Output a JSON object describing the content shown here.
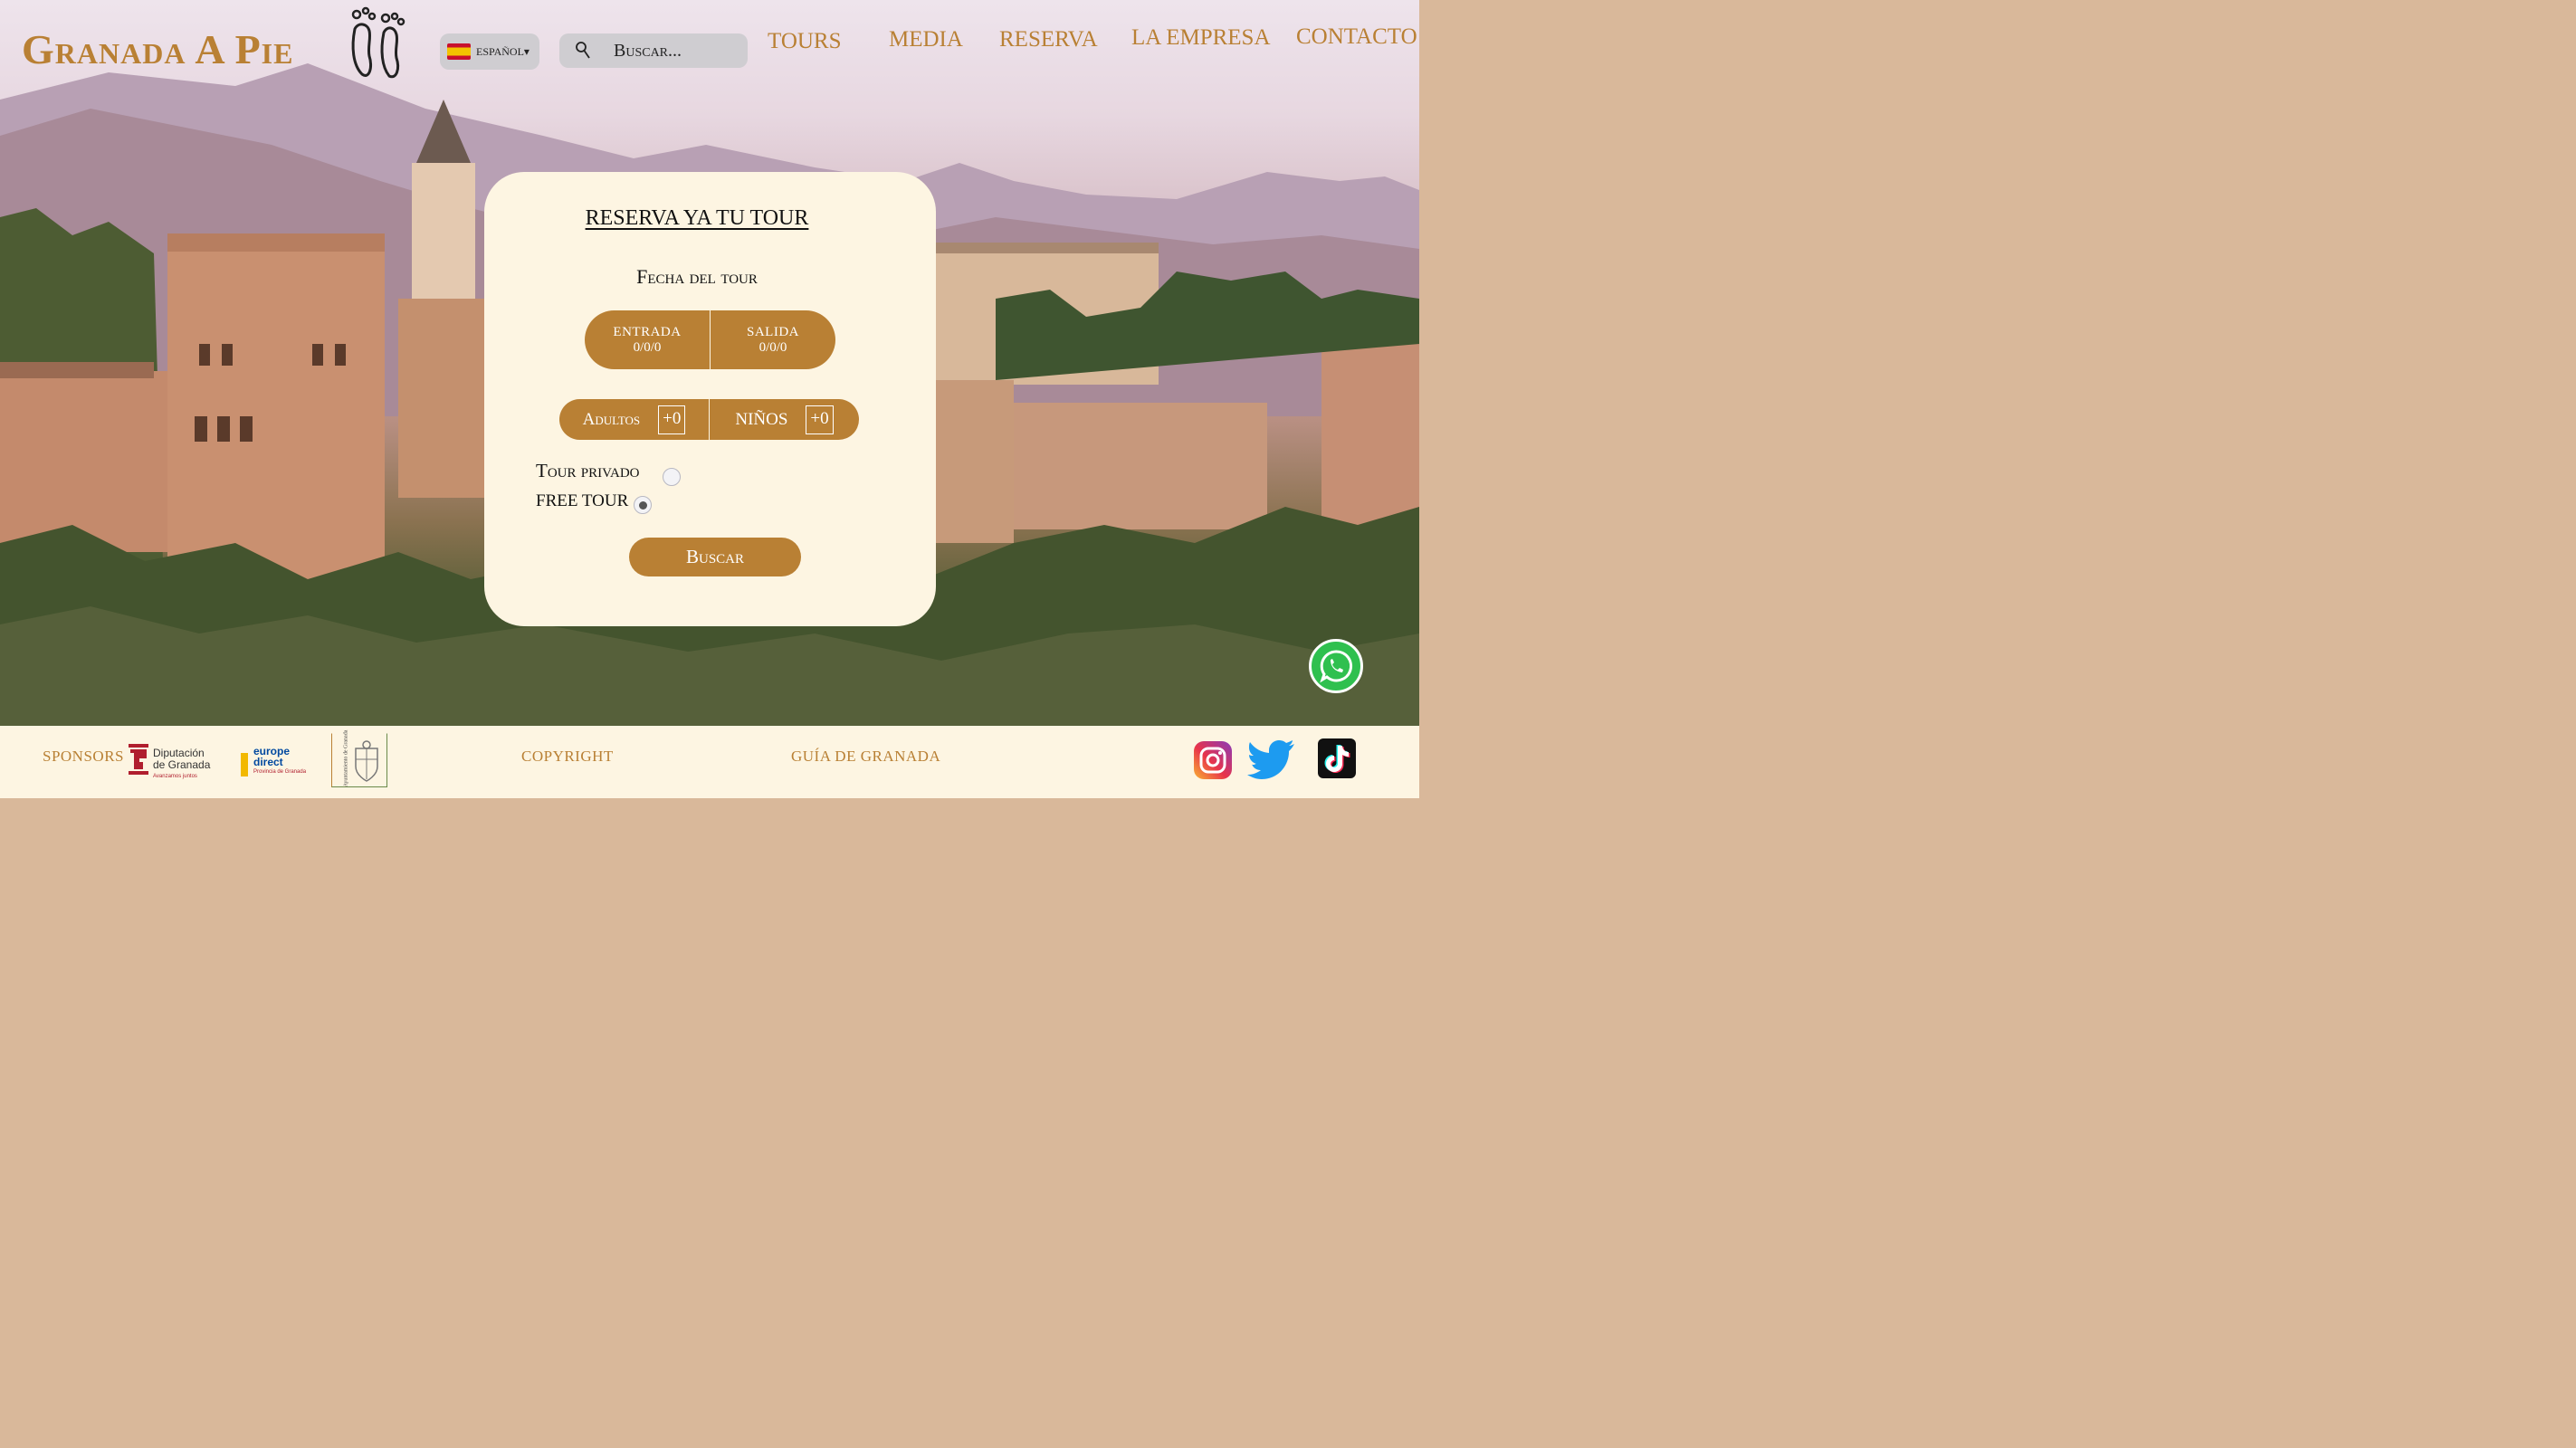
{
  "header": {
    "logo_text": "Granada A Pie",
    "language": {
      "label": "ESPAÑOL▾",
      "flag": "spain-flag"
    },
    "search": {
      "placeholder": "Buscar..."
    },
    "nav": [
      "TOURS",
      "MEDIA",
      "RESERVA",
      "LA EMPRESA",
      "CONTACTO"
    ]
  },
  "booking": {
    "title": "RESERVA YA TU TOUR",
    "date_label": "Fecha del tour",
    "entrada_label": "ENTRADA",
    "entrada_value": "0/0/0",
    "salida_label": "SALIDA",
    "salida_value": "0/0/0",
    "adultos_label": "Adultos",
    "adultos_value": "+0",
    "ninos_label": "NIÑOS",
    "ninos_value": "+0",
    "options": [
      {
        "label": "Tour privado",
        "selected": false
      },
      {
        "label": "FREE TOUR",
        "selected": true
      }
    ],
    "submit_label": "Buscar"
  },
  "footer": {
    "sponsors_label": "SPONSORS",
    "sponsors": [
      {
        "name": "Diputación de Granada",
        "line1": "Diputación",
        "line2": "de Granada",
        "tagline": "Avanzamos juntos"
      },
      {
        "name": "europe direct",
        "line1": "europe",
        "line2": "direct",
        "tagline": "Provincia de Granada"
      },
      {
        "name": "Ayuntamiento de Granada",
        "text": "Ayuntamiento de Granada"
      }
    ],
    "copyright_label": "COPYRIGHT",
    "guide_label": "GUÍA DE GRANADA",
    "social": [
      "instagram-icon",
      "twitter-icon",
      "tiktok-icon"
    ]
  },
  "colors": {
    "accent": "#b98034",
    "card_bg": "#fdf5e2",
    "whatsapp": "#2fc04f"
  }
}
